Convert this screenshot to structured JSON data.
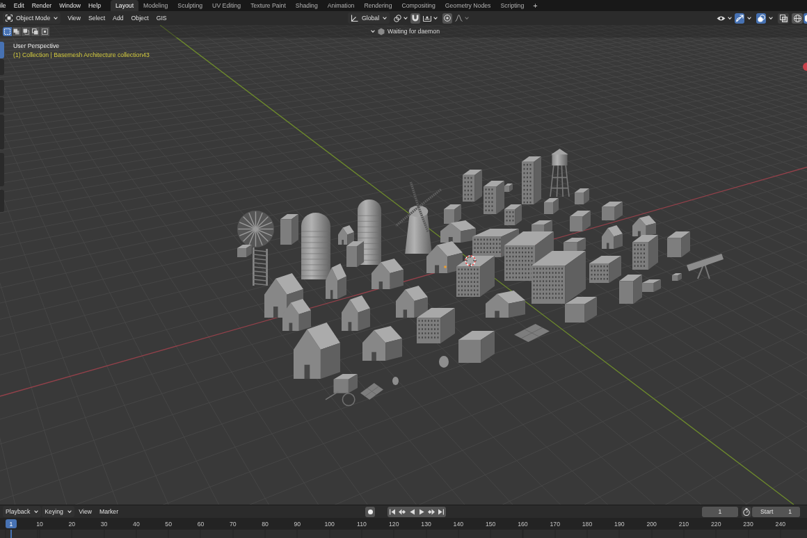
{
  "topbar": {
    "menus": [
      "ile",
      "Edit",
      "Render",
      "Window",
      "Help"
    ],
    "workspaces": [
      {
        "label": "Layout",
        "selected": true
      },
      {
        "label": "Modeling",
        "selected": false
      },
      {
        "label": "Sculpting",
        "selected": false
      },
      {
        "label": "UV Editing",
        "selected": false
      },
      {
        "label": "Texture Paint",
        "selected": false
      },
      {
        "label": "Shading",
        "selected": false
      },
      {
        "label": "Animation",
        "selected": false
      },
      {
        "label": "Rendering",
        "selected": false
      },
      {
        "label": "Compositing",
        "selected": false
      },
      {
        "label": "Geometry Nodes",
        "selected": false
      },
      {
        "label": "Scripting",
        "selected": false
      }
    ],
    "add_workspace": "+"
  },
  "header": {
    "mode": "Object Mode",
    "menus": [
      "View",
      "Select",
      "Add",
      "Object",
      "GIS"
    ],
    "orientation": "Global",
    "gizmos": {
      "on": true
    },
    "overlays": {
      "on": true
    },
    "xray": {
      "on": false
    },
    "shading": [
      {
        "selected": false
      },
      {
        "selected": true
      }
    ]
  },
  "tool_header": {
    "selection_modes": [
      {
        "selected": true
      },
      {
        "selected": false
      },
      {
        "selected": false
      },
      {
        "selected": false
      },
      {
        "selected": false
      }
    ],
    "status": "Waiting for daemon"
  },
  "toolbar": {
    "tools": [
      {
        "selected": true
      },
      {
        "selected": false
      },
      {
        "selected": false
      },
      {
        "selected": false
      },
      {
        "selected": false
      },
      {
        "selected": false
      },
      {
        "selected": false
      }
    ]
  },
  "viewport": {
    "view_name": "User Perspective",
    "collection_info": "(1) Collection | Basemesh Architecture collection43"
  },
  "timeline": {
    "menus": [
      {
        "label": "Playback",
        "kind": "dropdown"
      },
      {
        "label": "Keying",
        "kind": "dropdown"
      },
      {
        "label": "View",
        "kind": "menu"
      },
      {
        "label": "Marker",
        "kind": "menu"
      }
    ],
    "current_frame": "1",
    "start_label": "Start",
    "start_frame": "1",
    "playhead_frame": "1",
    "ruler_labels": [
      "10",
      "20",
      "30",
      "40",
      "50",
      "60",
      "70",
      "80",
      "90",
      "100",
      "110",
      "120",
      "130",
      "140",
      "150",
      "160",
      "170",
      "180",
      "190",
      "200",
      "210",
      "220",
      "230",
      "240"
    ]
  }
}
